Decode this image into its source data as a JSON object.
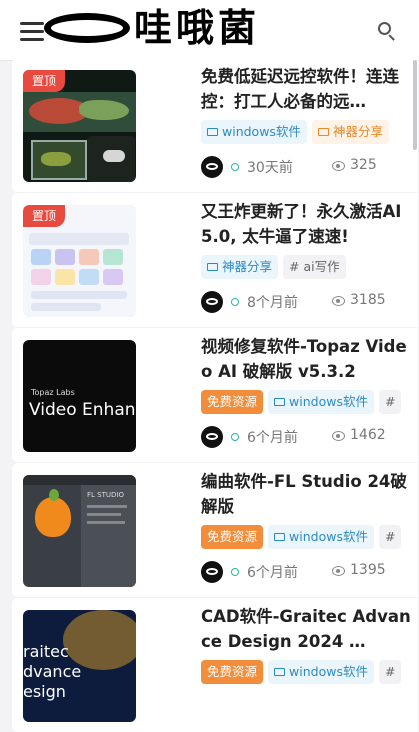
{
  "header": {
    "logo_text": "哇哦菌",
    "menu_icon": "menu-icon",
    "search_icon": "search-icon"
  },
  "posts": [
    {
      "sticky": "置顶",
      "title": "免费低延迟远控软件！连连控：打工人必备的远…",
      "tags": [
        {
          "label": "windows软件",
          "style": "blue",
          "icon": "folder-icon"
        },
        {
          "label": "神器分享",
          "style": "orange-outline",
          "icon": "folder-icon"
        }
      ],
      "time": "30天前",
      "views": "325",
      "thumb": "remote-control-screens"
    },
    {
      "sticky": "置顶",
      "title": "又王炸更新了！永久激活AI5.0, 太牛逼了速速!",
      "tags": [
        {
          "label": "神器分享",
          "style": "blue",
          "icon": "folder-icon"
        },
        {
          "label": "# ai写作",
          "style": "grey",
          "icon": ""
        }
      ],
      "time": "8个月前",
      "views": "3185",
      "thumb": "ai-writing-dashboard"
    },
    {
      "sticky": "",
      "title": "视频修复软件-Topaz Video AI 破解版 v5.3.2",
      "tags": [
        {
          "label": "免费资源",
          "style": "orange-solid",
          "icon": ""
        },
        {
          "label": "windows软件",
          "style": "blue",
          "icon": "folder-icon"
        },
        {
          "label": "#",
          "style": "grey",
          "icon": ""
        }
      ],
      "time": "6个月前",
      "views": "1462",
      "thumb": "topaz-video-enhance",
      "thumb_text_small": "Topaz Labs",
      "thumb_text_big": "Video Enhan"
    },
    {
      "sticky": "",
      "title": "编曲软件-FL Studio 24破解版",
      "tags": [
        {
          "label": "免费资源",
          "style": "orange-solid",
          "icon": ""
        },
        {
          "label": "windows软件",
          "style": "blue",
          "icon": "folder-icon"
        },
        {
          "label": "#",
          "style": "grey",
          "icon": ""
        }
      ],
      "time": "6个月前",
      "views": "1395",
      "thumb": "fl-studio-splash",
      "thumb_text_small": "FL STUDIO"
    },
    {
      "sticky": "",
      "title": "CAD软件-Graitec Advance Design 2024 …",
      "tags": [
        {
          "label": "免费资源",
          "style": "orange-solid",
          "icon": ""
        },
        {
          "label": "windows软件",
          "style": "blue",
          "icon": "folder-icon"
        },
        {
          "label": "#",
          "style": "grey",
          "icon": ""
        }
      ],
      "time": "",
      "views": "",
      "thumb": "graitec-advance-design",
      "thumb_text_big": "raitec\ndvance\nesign"
    }
  ],
  "colors": {
    "sticky_red": "#e84a3f",
    "tag_blue": "#2d8bc2",
    "tag_orange": "#f18d3b",
    "clock_teal": "#2cb5a0"
  }
}
